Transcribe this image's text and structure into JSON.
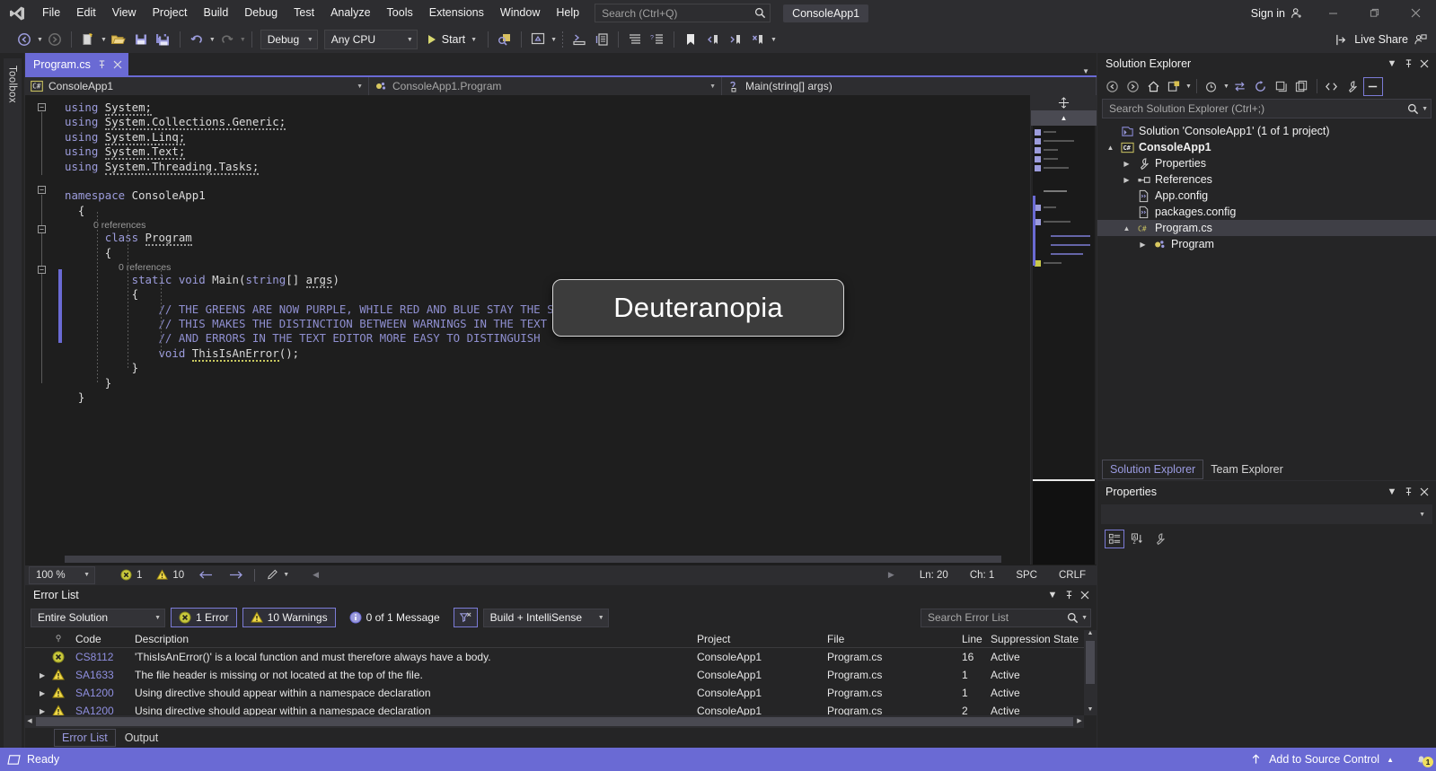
{
  "window": {
    "solution_badge": "ConsoleApp1",
    "sign_in": "Sign in",
    "live_share": "Live Share",
    "minimize": "—",
    "maximize": "▢",
    "close": "✕"
  },
  "menu": {
    "items": [
      "File",
      "Edit",
      "View",
      "Project",
      "Build",
      "Debug",
      "Test",
      "Analyze",
      "Tools",
      "Extensions",
      "Window",
      "Help"
    ]
  },
  "search": {
    "placeholder": "Search (Ctrl+Q)"
  },
  "toolbar": {
    "config": "Debug",
    "platform": "Any CPU",
    "start": "Start"
  },
  "toolbox": {
    "label": "Toolbox"
  },
  "editor": {
    "tab": {
      "title": "Program.cs",
      "pin": "⌐",
      "close": "✕"
    },
    "nav": {
      "project": "ConsoleApp1",
      "type": "ConsoleApp1.Program",
      "member": "Main(string[] args)"
    },
    "lines": [
      {
        "kind": "code",
        "indent": 0,
        "fold": "minus",
        "text": "using System;",
        "tokens": [
          {
            "t": "using ",
            "c": "kw"
          },
          {
            "t": "System;",
            "c": "sq"
          }
        ]
      },
      {
        "kind": "code",
        "indent": 0,
        "text": "using System.Collections.Generic;"
      },
      {
        "kind": "code",
        "indent": 0,
        "text": "using System.Linq;"
      },
      {
        "kind": "code",
        "indent": 0,
        "text": "using System.Text;"
      },
      {
        "kind": "code",
        "indent": 0,
        "text": "using System.Threading.Tasks;"
      },
      {
        "kind": "blank",
        "text": ""
      },
      {
        "kind": "code",
        "indent": 0,
        "fold": "minus",
        "text": "namespace ConsoleApp1"
      },
      {
        "kind": "code",
        "indent": 0,
        "text": "{"
      },
      {
        "kind": "ref",
        "indent": 1,
        "text": "0 references"
      },
      {
        "kind": "code",
        "indent": 1,
        "fold": "minus",
        "text": "class Program"
      },
      {
        "kind": "code",
        "indent": 1,
        "text": "{"
      },
      {
        "kind": "ref",
        "indent": 2,
        "text": "0 references"
      },
      {
        "kind": "code",
        "indent": 2,
        "fold": "minus",
        "text": "static void Main(string[] args)"
      },
      {
        "kind": "code",
        "indent": 2,
        "text": "{"
      },
      {
        "kind": "comment",
        "indent": 3,
        "text": "// THE GREENS ARE NOW PURPLE, WHILE RED AND BLUE STAY THE SAME COLOUR"
      },
      {
        "kind": "comment",
        "indent": 3,
        "text": "// THIS MAKES THE DISTINCTION BETWEEN WARNINGS IN THE TEXT EDITOR"
      },
      {
        "kind": "comment",
        "indent": 3,
        "text": "// AND ERRORS IN THE TEXT EDITOR MORE EASY TO DISTINGUISH"
      },
      {
        "kind": "code",
        "indent": 3,
        "text": "void ThisIsAnError();"
      },
      {
        "kind": "code",
        "indent": 2,
        "text": "}"
      },
      {
        "kind": "code",
        "indent": 1,
        "text": "}"
      },
      {
        "kind": "code",
        "indent": 0,
        "text": "}"
      }
    ],
    "status": {
      "zoom": "100 %",
      "error_count": "1",
      "warning_count": "10",
      "line": "Ln: 20",
      "col": "Ch: 1",
      "spaces": "SPC",
      "eol": "CRLF"
    }
  },
  "overlay": {
    "label": "Deuteranopia"
  },
  "solution_explorer": {
    "title": "Solution Explorer",
    "search_placeholder": "Search Solution Explorer (Ctrl+;)",
    "tree": [
      {
        "label": "Solution 'ConsoleApp1' (1 of 1 project)",
        "depth": 0,
        "icon": "solution-icon",
        "expander": "",
        "bold": false,
        "selected": false
      },
      {
        "label": "ConsoleApp1",
        "depth": 1,
        "icon": "csproj-icon",
        "expander": "▲",
        "bold": true,
        "selected": false
      },
      {
        "label": "Properties",
        "depth": 2,
        "icon": "wrench-icon",
        "expander": "▶",
        "bold": false,
        "selected": false
      },
      {
        "label": "References",
        "depth": 2,
        "icon": "references-icon",
        "expander": "▶",
        "bold": false,
        "selected": false
      },
      {
        "label": "App.config",
        "depth": 2,
        "icon": "config-file-icon",
        "expander": "",
        "bold": false,
        "selected": false
      },
      {
        "label": "packages.config",
        "depth": 2,
        "icon": "config-file-icon",
        "expander": "",
        "bold": false,
        "selected": false
      },
      {
        "label": "Program.cs",
        "depth": 2,
        "icon": "csharp-file-icon",
        "expander": "▲",
        "bold": false,
        "selected": true
      },
      {
        "label": "Program",
        "depth": 3,
        "icon": "class-icon",
        "expander": "▶",
        "bold": false,
        "selected": false
      }
    ],
    "tabs": [
      {
        "label": "Solution Explorer",
        "active": true
      },
      {
        "label": "Team Explorer",
        "active": false
      }
    ]
  },
  "properties": {
    "title": "Properties"
  },
  "error_list": {
    "title": "Error List",
    "scope": "Entire Solution",
    "errors_label": "1 Error",
    "warnings_label": "10 Warnings",
    "messages_label": "0 of 1 Message",
    "build_filter": "Build + IntelliSense",
    "search_placeholder": "Search Error List",
    "columns": [
      "",
      "",
      "Code",
      "Description",
      "Project",
      "File",
      "Line",
      "Suppression State"
    ],
    "rows": [
      {
        "severity": "error",
        "expander": "",
        "code": "CS8112",
        "description": "'ThisIsAnError()' is a local function and must therefore always have a body.",
        "project": "ConsoleApp1",
        "file": "Program.cs",
        "line": "16",
        "suppression": "Active"
      },
      {
        "severity": "warning",
        "expander": "▶",
        "code": "SA1633",
        "description": "The file header is missing or not located at the top of the file.",
        "project": "ConsoleApp1",
        "file": "Program.cs",
        "line": "1",
        "suppression": "Active"
      },
      {
        "severity": "warning",
        "expander": "▶",
        "code": "SA1200",
        "description": "Using directive should appear within a namespace declaration",
        "project": "ConsoleApp1",
        "file": "Program.cs",
        "line": "1",
        "suppression": "Active"
      },
      {
        "severity": "warning",
        "expander": "▶",
        "code": "SA1200",
        "description": "Using directive should appear within a namespace declaration",
        "project": "ConsoleApp1",
        "file": "Program.cs",
        "line": "2",
        "suppression": "Active"
      }
    ],
    "bottom_tabs": [
      {
        "label": "Error List",
        "active": true
      },
      {
        "label": "Output",
        "active": false
      }
    ]
  },
  "statusbar": {
    "ready": "Ready",
    "source_control": "Add to Source Control",
    "notification_count": "1"
  },
  "colors": {
    "accent": "#6a6ad4",
    "comment": "#8f8fd0",
    "keyword": "#9c9cdc",
    "error": "#c8c83c",
    "warning": "#f0d94a",
    "info": "#8f8fe0",
    "chrome": "#2d2d30",
    "editor_bg": "#1e1e1e"
  }
}
